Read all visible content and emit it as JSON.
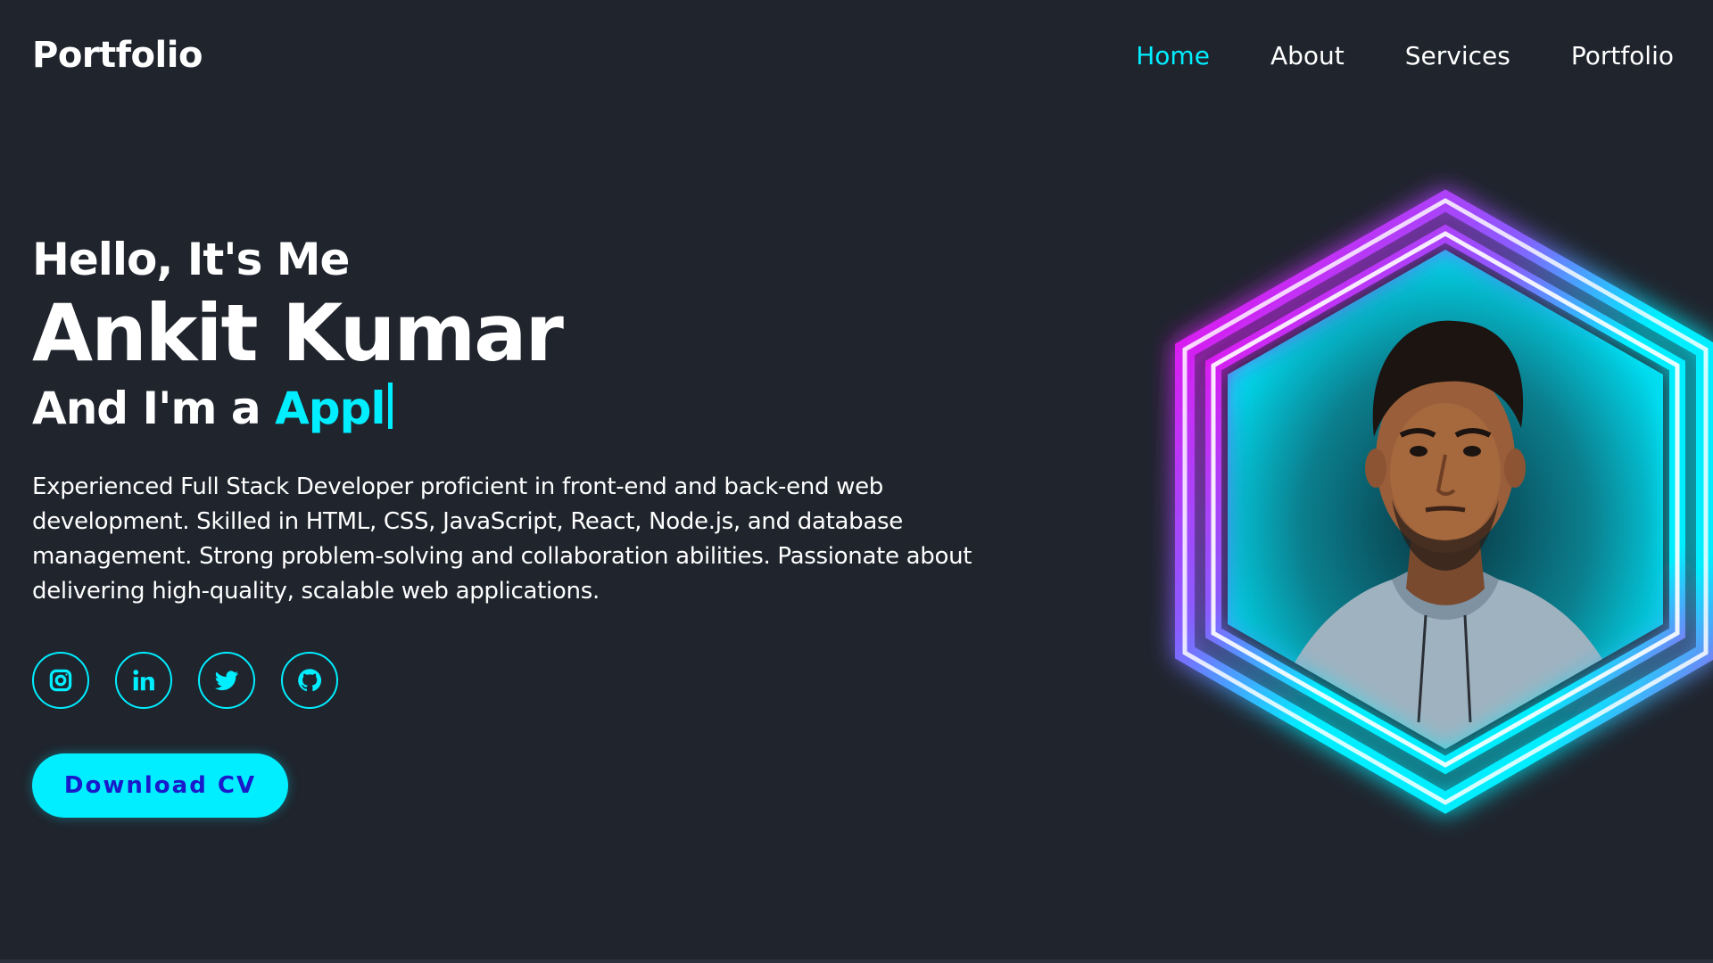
{
  "header": {
    "logo": "Portfolio",
    "nav": [
      {
        "label": "Home",
        "active": true
      },
      {
        "label": "About",
        "active": false
      },
      {
        "label": "Services",
        "active": false
      },
      {
        "label": "Portfolio",
        "active": false
      }
    ]
  },
  "home": {
    "greeting": "Hello, It's Me",
    "name": "Ankit Kumar",
    "role_prefix": "And I'm a",
    "role_typed": "Appl",
    "description": "Experienced Full Stack Developer proficient in front-end and back-end web development. Skilled in HTML, CSS, JavaScript, React, Node.js, and database management. Strong problem-solving and collaboration abilities. Passionate about delivering high-quality, scalable web applications.",
    "social": [
      {
        "name": "instagram-icon"
      },
      {
        "name": "linkedin-icon"
      },
      {
        "name": "twitter-icon"
      },
      {
        "name": "github-icon"
      }
    ],
    "cta_label": "Download CV"
  },
  "colors": {
    "background": "#1f242d",
    "accent": "#00eeff",
    "glow_magenta": "#ff00ea",
    "text": "#ffffff",
    "button_text": "#1a1acb"
  }
}
